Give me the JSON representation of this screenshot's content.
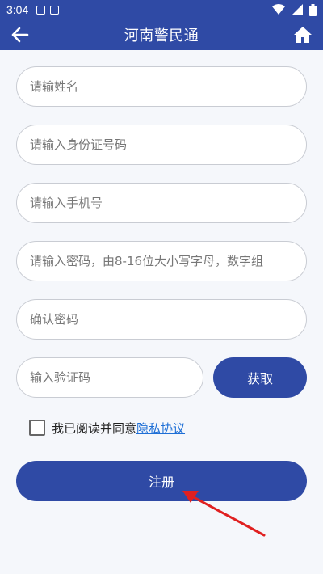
{
  "status_bar": {
    "time": "3:04"
  },
  "app_bar": {
    "title": "河南警民通"
  },
  "form": {
    "name_placeholder": "请输姓名",
    "id_placeholder": "请输入身份证号码",
    "phone_placeholder": "请输入手机号",
    "password_placeholder": "请输入密码，由8-16位大小写字母，数字组",
    "confirm_placeholder": "确认密码",
    "code_placeholder": "输入验证码",
    "get_code_label": "获取",
    "agree_text": "我已阅读并同意",
    "privacy_link": "隐私协议",
    "register_label": "注册"
  },
  "colors": {
    "primary": "#2f4aa5",
    "link": "#1e6fd6",
    "annotation_arrow": "#e02020"
  }
}
